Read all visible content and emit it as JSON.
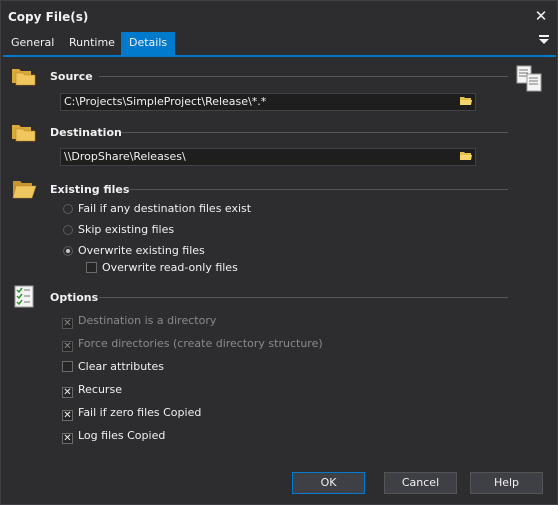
{
  "window": {
    "title": "Copy File(s)",
    "close_glyph": "✕"
  },
  "tabs": [
    {
      "label": "General"
    },
    {
      "label": "Runtime"
    },
    {
      "label": "Details"
    }
  ],
  "source": {
    "heading": "Source",
    "path": "C:\\Projects\\SimpleProject\\Release\\*.*"
  },
  "destination": {
    "heading": "Destination",
    "path": "\\\\DropShare\\Releases\\"
  },
  "existing": {
    "heading": "Existing files",
    "options": [
      {
        "label": "Fail if any destination files exist",
        "selected": false
      },
      {
        "label": "Skip existing files",
        "selected": false
      },
      {
        "label": "Overwrite existing files",
        "selected": true
      }
    ],
    "overwrite_readonly": {
      "label": "Overwrite read-only files",
      "checked": false
    }
  },
  "options": {
    "heading": "Options",
    "items": [
      {
        "label": "Destination is a directory",
        "checked": true,
        "enabled": false
      },
      {
        "label": "Force directories (create directory structure)",
        "checked": true,
        "enabled": false
      },
      {
        "label": "Clear attributes",
        "checked": false,
        "enabled": true
      },
      {
        "label": "Recurse",
        "checked": true,
        "enabled": true
      },
      {
        "label": "Fail if zero files Copied",
        "checked": true,
        "enabled": true
      },
      {
        "label": "Log files Copied",
        "checked": true,
        "enabled": true
      }
    ]
  },
  "buttons": {
    "ok": "OK",
    "cancel": "Cancel",
    "help": "Help"
  },
  "colors": {
    "accent": "#007acc",
    "background": "#2d2d30",
    "field": "#1e1e1e"
  },
  "icons": {
    "source": "folder-copy-icon",
    "destination": "folder-paste-icon",
    "existing": "folder-open-icon",
    "options": "checklist-icon",
    "side": "copy-documents-icon",
    "browse": "browse-folder-icon",
    "tabmenu": "tab-menu-icon"
  }
}
